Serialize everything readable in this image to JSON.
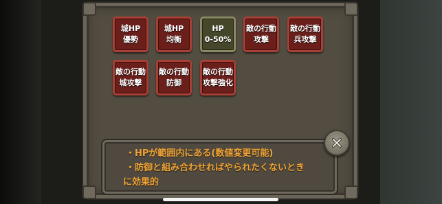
{
  "filters": {
    "row1": [
      {
        "line1": "城HP",
        "line2": "優勢",
        "style": "red"
      },
      {
        "line1": "城HP",
        "line2": "均衡",
        "style": "red"
      },
      {
        "line1": "HP",
        "line2": "0-50%",
        "style": "olive"
      },
      {
        "line1": "敵の行動",
        "line2": "攻撃",
        "style": "red"
      },
      {
        "line1": "敵の行動",
        "line2": "兵攻撃",
        "style": "red"
      }
    ],
    "row2": [
      {
        "line1": "敵の行動",
        "line2": "城攻撃",
        "style": "red"
      },
      {
        "line1": "敵の行動",
        "line2": "防御",
        "style": "red"
      },
      {
        "line1": "敵の行動",
        "line2": "攻撃強化",
        "style": "red"
      }
    ]
  },
  "description": {
    "line1": "・HPが範囲内にある(数値変更可能)",
    "line2": "・防御と組み合わせればやられたくないとき",
    "line3": "に効果的"
  },
  "icons": {
    "close": "close-x-icon"
  },
  "colors": {
    "tag_red": "#6a1f1b",
    "tag_olive": "#46462a",
    "description_text": "#f0a437",
    "panel": "#524c41"
  }
}
